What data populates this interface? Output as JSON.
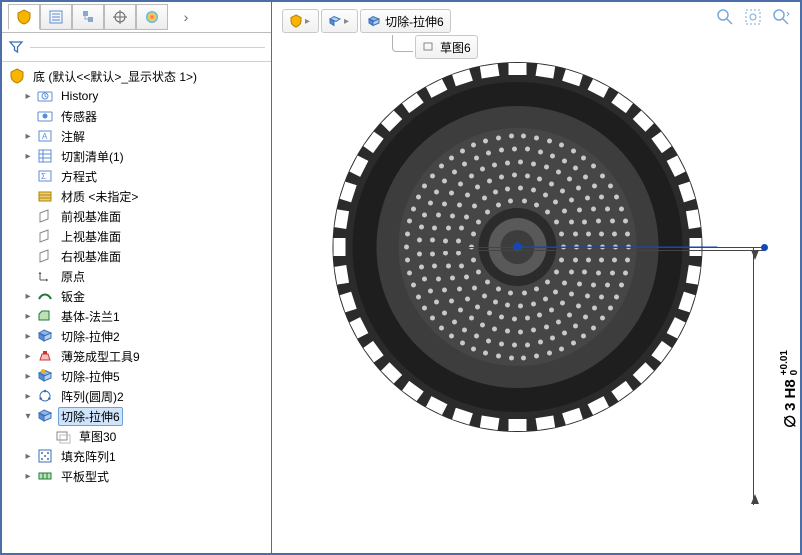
{
  "panel_tabs": {
    "more": "›"
  },
  "root": {
    "name": "底 (默认<<默认>_显示状态 1>)"
  },
  "tree": {
    "history": "History",
    "sensors": "传感器",
    "annotations": "注解",
    "cutlist": "切割清单(1)",
    "equations": "方程式",
    "material": "材质 <未指定>",
    "front_plane": "前视基准面",
    "top_plane": "上视基准面",
    "right_plane": "右视基准面",
    "origin": "原点",
    "sheetmetal": "钣金",
    "base_flange": "基体-法兰1",
    "cut_extrude2": "切除-拉伸2",
    "form_tool9": "薄笼成型工具9",
    "cut_extrude5": "切除-拉伸5",
    "pattern_circ2": "阵列(圆周)2",
    "cut_extrude6": "切除-拉伸6",
    "sketch30": "草图30",
    "fill_pattern1": "填充阵列1",
    "flat_pattern": "平板型式"
  },
  "breadcrumb": {
    "current": "切除-拉伸6",
    "child": "草图6"
  },
  "dimension": {
    "symbol": "∅",
    "value": "3",
    "fit": "H8",
    "tol_upper": "+0.01",
    "tol_lower": "0"
  }
}
